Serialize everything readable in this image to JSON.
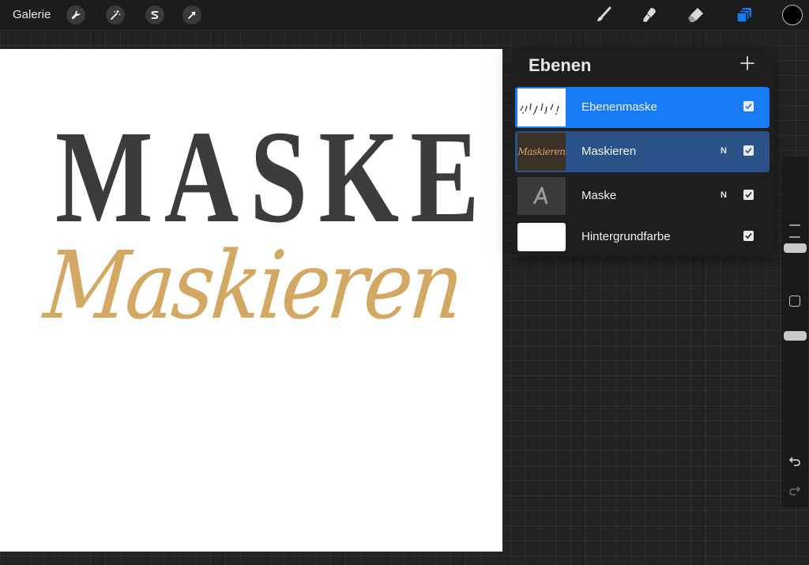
{
  "topbar": {
    "gallery_label": "Galerie",
    "left_tools": [
      "wrench-icon",
      "magic-wand-icon",
      "selection-s-icon",
      "transform-arrow-icon"
    ],
    "right_tools": [
      "brush-icon",
      "smudge-icon",
      "eraser-icon",
      "layers-icon"
    ],
    "active_tool": "layers-icon",
    "current_color": "#000000",
    "accent_color": "#1a7cf5"
  },
  "canvas": {
    "title_text": "MASKE",
    "script_text": "Maskieren",
    "title_color": "#3c3c3c",
    "script_color": "#d3a863"
  },
  "layers_panel": {
    "title": "Ebenen",
    "add_label": "+",
    "layers": [
      {
        "name": "Ebenenmaske",
        "blend": "",
        "visible": true,
        "state": "selected-primary",
        "thumb_text": "",
        "thumb_icon": "mask-thumbnail"
      },
      {
        "name": "Maskieren",
        "blend": "N",
        "visible": true,
        "state": "selected-secondary",
        "thumb_text": "Maskieren",
        "thumb_icon": ""
      },
      {
        "name": "Maske",
        "blend": "N",
        "visible": true,
        "state": "normal",
        "thumb_text": "",
        "thumb_icon": "text-layer-a-icon"
      },
      {
        "name": "Hintergrundfarbe",
        "blend": "",
        "visible": true,
        "state": "normal",
        "thumb_text": "",
        "thumb_icon": "white-swatch"
      }
    ]
  },
  "sidebar": {
    "brush_size_level": 0.92,
    "opacity_level": 0.95,
    "undo_icon": "undo-icon",
    "redo_icon": "redo-icon"
  }
}
